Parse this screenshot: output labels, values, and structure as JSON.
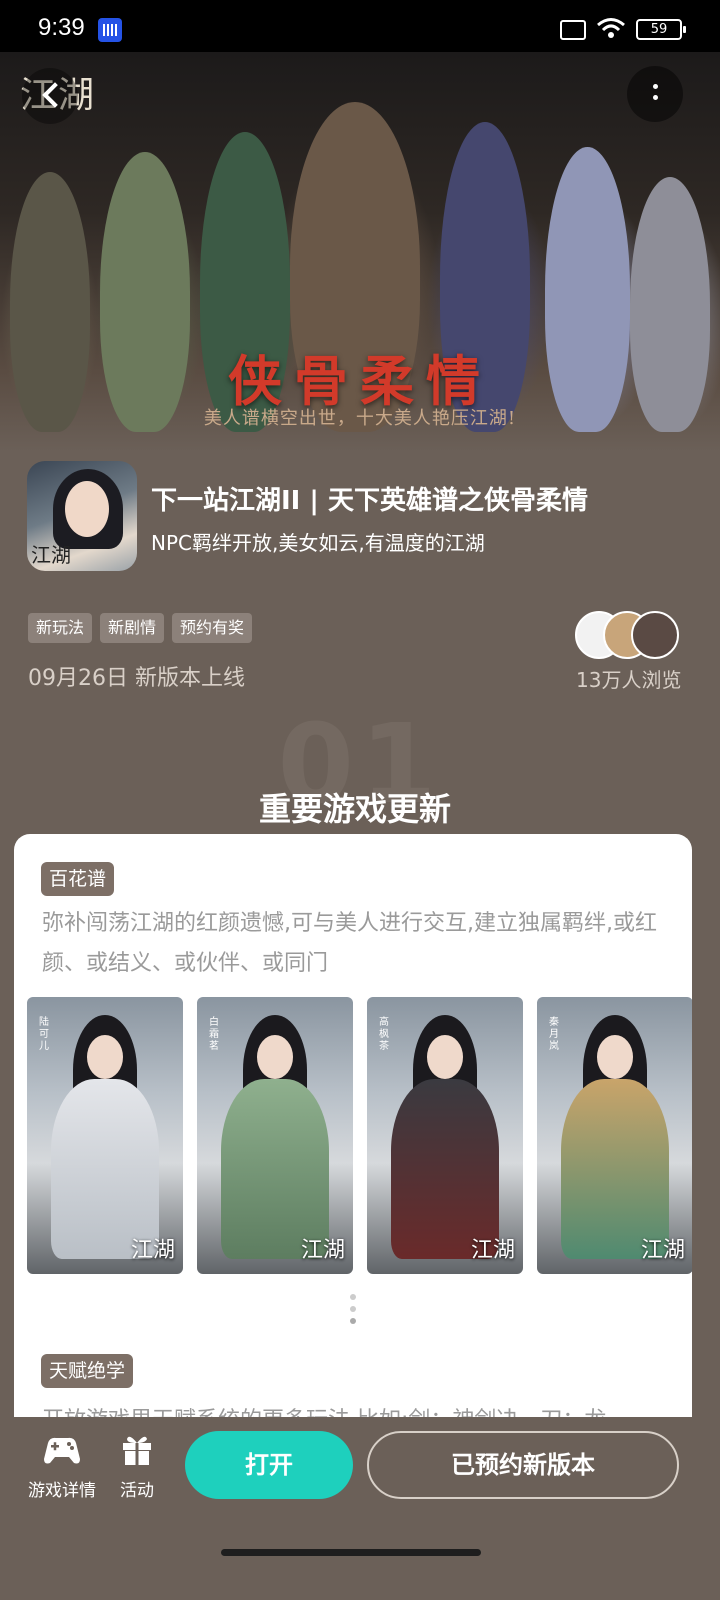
{
  "status_bar": {
    "time": "9:39",
    "battery": "59"
  },
  "hero": {
    "logo": "江湖",
    "art_title": "侠骨柔情",
    "slogan": "美人谱横空出世，十大美人艳压江湖!"
  },
  "game": {
    "icon_logo": "江湖",
    "title": "下一站江湖II | 天下英雄谱之侠骨柔情",
    "subtitle": "NPC羁绊开放,美女如云,有温度的江湖",
    "tags": [
      "新玩法",
      "新剧情",
      "预约有奖"
    ],
    "release": "09月26日 新版本上线",
    "views": "13万人浏览"
  },
  "section": {
    "number": "01",
    "title": "重要游戏更新"
  },
  "card": {
    "badge1": "百花谱",
    "desc1": "弥补闯荡江湖的红颜遗憾,可与美人进行交互,建立独属羁绊,或红颜、或结义、或伙伴、或同门",
    "portraits": [
      {
        "name": "陆可儿",
        "logo": "江湖"
      },
      {
        "name": "白霜茗",
        "logo": "江湖"
      },
      {
        "name": "高枫茶",
        "logo": "江湖"
      },
      {
        "name": "秦月岚",
        "logo": "江湖"
      }
    ],
    "badge2": "天赋绝学",
    "desc2": "开放游戏里天赋系统的更多玩法,比如:剑：神剑决，刀：龙"
  },
  "bottom_bar": {
    "details_label": "游戏详情",
    "activity_label": "活动",
    "open_label": "打开",
    "reserve_label": "已预约新版本"
  },
  "colors": {
    "accent": "#1ed0bd",
    "background": "#6b6058",
    "tag_bg": "#8c817a"
  }
}
